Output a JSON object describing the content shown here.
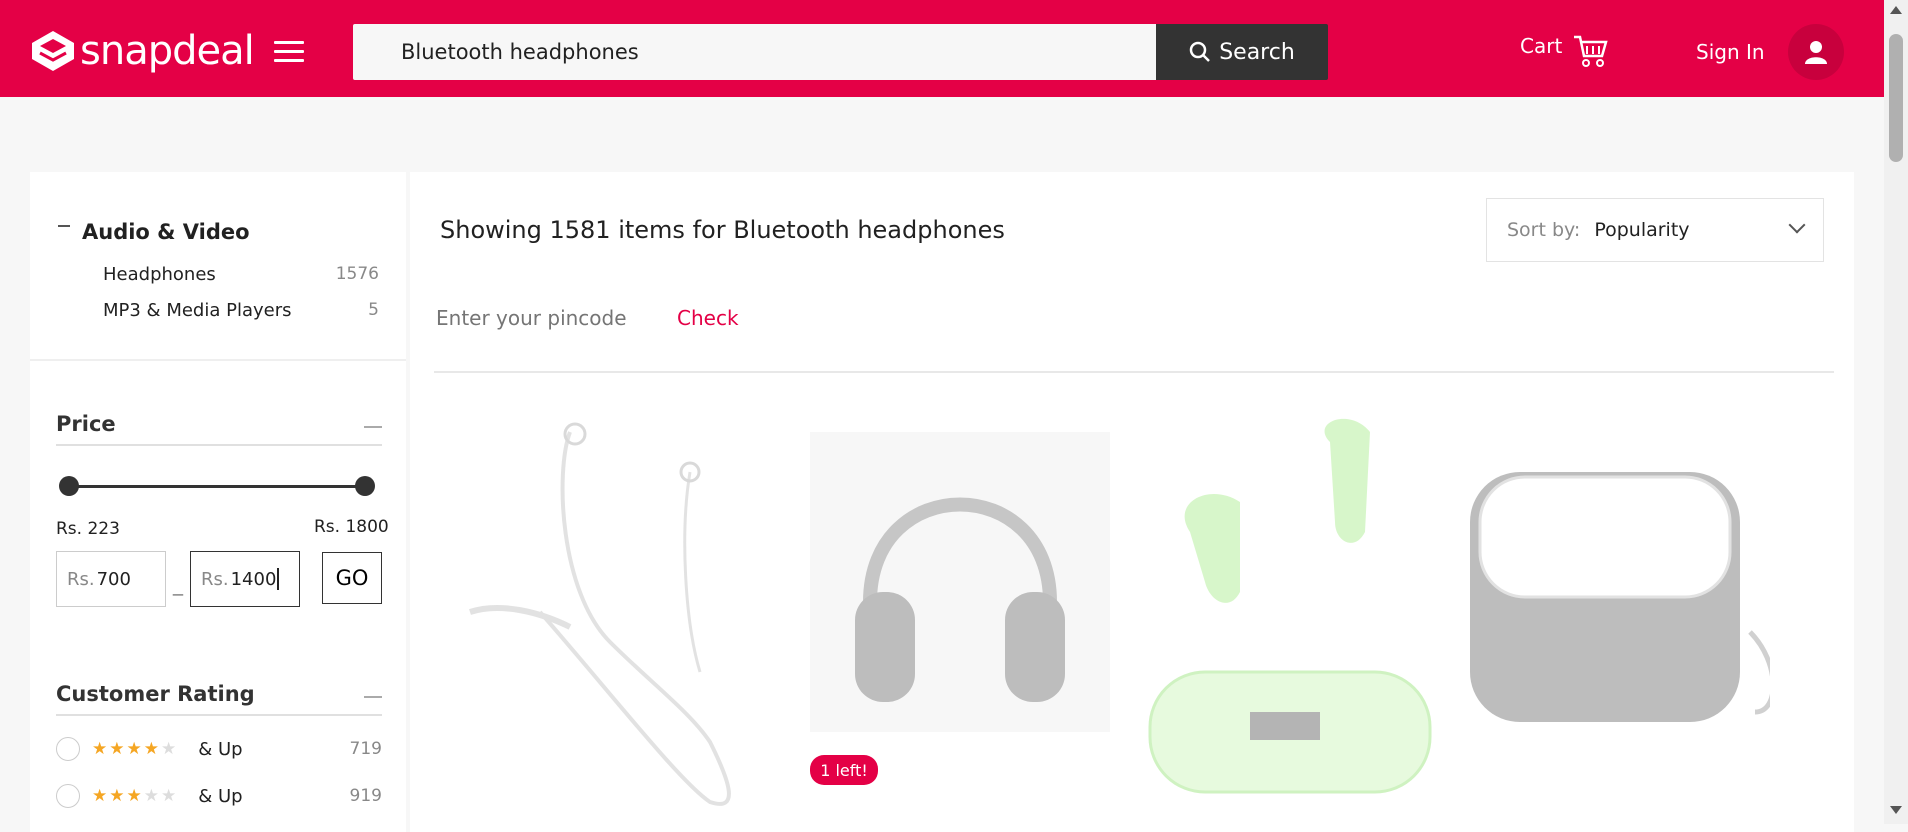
{
  "header": {
    "logo_text": "snapdeal",
    "search_value": "Bluetooth headphones",
    "search_button": "Search",
    "cart_label": "Cart",
    "signin_label": "Sign In"
  },
  "sidebar": {
    "category": {
      "title": "Audio & Video",
      "items": [
        {
          "label": "Headphones",
          "count": "1576"
        },
        {
          "label": "MP3 & Media Players",
          "count": "5"
        }
      ]
    },
    "price": {
      "title": "Price",
      "min_label": "Rs. 223",
      "max_label": "Rs. 1800",
      "rs_prefix": "Rs.",
      "from_value": "700",
      "to_value": "1400",
      "dash": "_",
      "go_label": "GO"
    },
    "rating": {
      "title": "Customer Rating",
      "rows": [
        {
          "stars": 4,
          "label": "& Up",
          "count": "719"
        },
        {
          "stars": 3,
          "label": "& Up",
          "count": "919"
        }
      ]
    }
  },
  "main": {
    "results_text": "Showing 1581 items for Bluetooth headphones",
    "sort_label": "Sort by:",
    "sort_value": "Popularity",
    "pincode_placeholder": "Enter your pincode",
    "check_label": "Check",
    "badge_text": "1 left!"
  },
  "colors": {
    "brand": "#e40046",
    "dark": "#333333"
  }
}
